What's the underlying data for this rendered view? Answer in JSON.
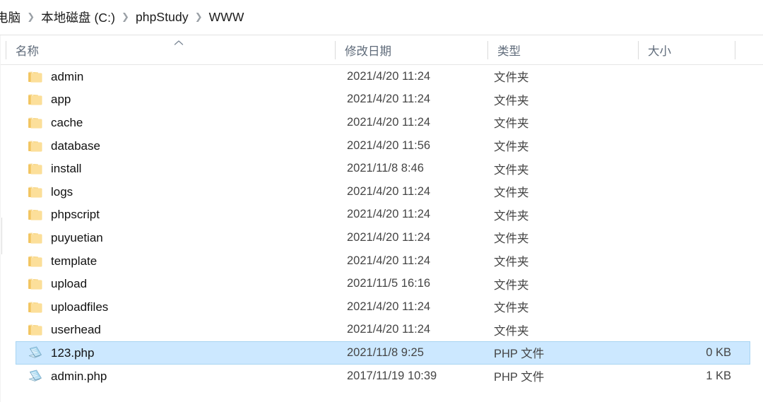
{
  "window": {
    "type": "file-explorer"
  },
  "breadcrumb": {
    "items": [
      {
        "label": "电脑",
        "clipped": true
      },
      {
        "label": "本地磁盘 (C:)",
        "clipped": false
      },
      {
        "label": "phpStudy",
        "clipped": false
      },
      {
        "label": "WWW",
        "clipped": false
      }
    ],
    "separator": "❯"
  },
  "columns": [
    {
      "key": "name",
      "label": "名称",
      "sorted": true,
      "sort_direction": "ascending"
    },
    {
      "key": "date",
      "label": "修改日期",
      "sorted": false,
      "sort_direction": ""
    },
    {
      "key": "type",
      "label": "类型",
      "sorted": false,
      "sort_direction": ""
    },
    {
      "key": "size",
      "label": "大小",
      "sorted": false,
      "sort_direction": ""
    }
  ],
  "colors": {
    "selection_fill": "#cce8ff",
    "selection_border": "#a8d4f2",
    "header_text": "#5f6b7a",
    "folder_icon": "#fcd77f",
    "php_icon": "#7ec4e8"
  },
  "files": [
    {
      "name": "admin",
      "date": "2021/4/20 11:24",
      "type": "文件夹",
      "size": "",
      "icon": "folder-icon",
      "selected": false
    },
    {
      "name": "app",
      "date": "2021/4/20 11:24",
      "type": "文件夹",
      "size": "",
      "icon": "folder-icon",
      "selected": false
    },
    {
      "name": "cache",
      "date": "2021/4/20 11:24",
      "type": "文件夹",
      "size": "",
      "icon": "folder-icon",
      "selected": false
    },
    {
      "name": "database",
      "date": "2021/4/20 11:56",
      "type": "文件夹",
      "size": "",
      "icon": "folder-icon",
      "selected": false
    },
    {
      "name": "install",
      "date": "2021/11/8 8:46",
      "type": "文件夹",
      "size": "",
      "icon": "folder-icon",
      "selected": false
    },
    {
      "name": "logs",
      "date": "2021/4/20 11:24",
      "type": "文件夹",
      "size": "",
      "icon": "folder-icon",
      "selected": false
    },
    {
      "name": "phpscript",
      "date": "2021/4/20 11:24",
      "type": "文件夹",
      "size": "",
      "icon": "folder-icon",
      "selected": false
    },
    {
      "name": "puyuetian",
      "date": "2021/4/20 11:24",
      "type": "文件夹",
      "size": "",
      "icon": "folder-icon",
      "selected": false
    },
    {
      "name": "template",
      "date": "2021/4/20 11:24",
      "type": "文件夹",
      "size": "",
      "icon": "folder-icon",
      "selected": false
    },
    {
      "name": "upload",
      "date": "2021/11/5 16:16",
      "type": "文件夹",
      "size": "",
      "icon": "folder-icon",
      "selected": false
    },
    {
      "name": "uploadfiles",
      "date": "2021/4/20 11:24",
      "type": "文件夹",
      "size": "",
      "icon": "folder-icon",
      "selected": false
    },
    {
      "name": "userhead",
      "date": "2021/4/20 11:24",
      "type": "文件夹",
      "size": "",
      "icon": "folder-icon",
      "selected": false
    },
    {
      "name": "123.php",
      "date": "2021/11/8 9:25",
      "type": "PHP 文件",
      "size": "0 KB",
      "icon": "php-file-icon",
      "selected": true
    },
    {
      "name": "admin.php",
      "date": "2017/11/19 10:39",
      "type": "PHP 文件",
      "size": "1 KB",
      "icon": "php-file-icon",
      "selected": false
    }
  ]
}
